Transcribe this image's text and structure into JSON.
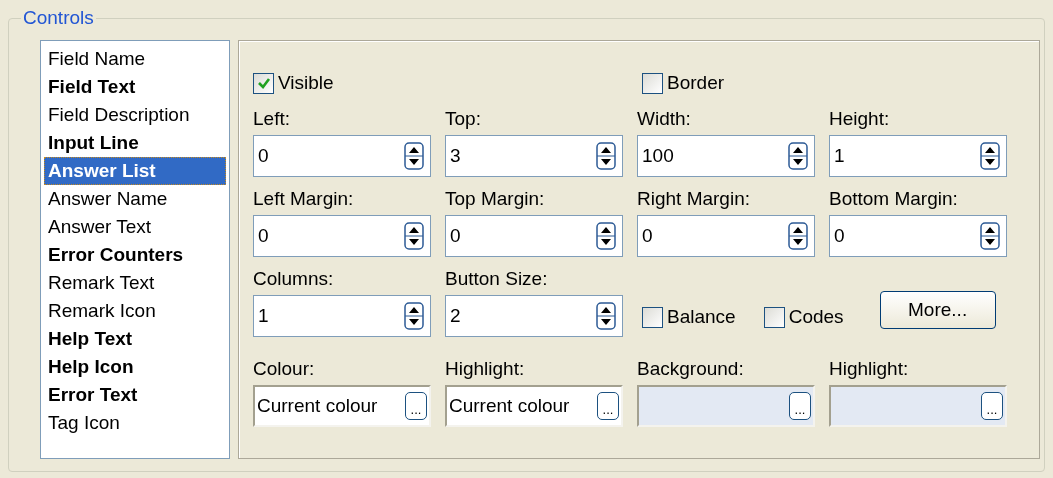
{
  "group_title": "Controls",
  "list": [
    {
      "label": "Field Name",
      "bold": false,
      "selected": false
    },
    {
      "label": "Field Text",
      "bold": true,
      "selected": false
    },
    {
      "label": "Field Description",
      "bold": false,
      "selected": false
    },
    {
      "label": "Input Line",
      "bold": true,
      "selected": false
    },
    {
      "label": "Answer List",
      "bold": true,
      "selected": true
    },
    {
      "label": "Answer Name",
      "bold": false,
      "selected": false
    },
    {
      "label": "Answer Text",
      "bold": false,
      "selected": false
    },
    {
      "label": "Error Counters",
      "bold": true,
      "selected": false
    },
    {
      "label": "Remark Text",
      "bold": false,
      "selected": false
    },
    {
      "label": "Remark Icon",
      "bold": false,
      "selected": false
    },
    {
      "label": "Help Text",
      "bold": true,
      "selected": false
    },
    {
      "label": "Help Icon",
      "bold": true,
      "selected": false
    },
    {
      "label": "Error Text",
      "bold": true,
      "selected": false
    },
    {
      "label": "Tag Icon",
      "bold": false,
      "selected": false
    }
  ],
  "visible": {
    "label": "Visible",
    "checked": true
  },
  "border": {
    "label": "Border",
    "checked": false
  },
  "spin_fields": [
    {
      "label": "Left:",
      "value": "0"
    },
    {
      "label": "Top:",
      "value": "3"
    },
    {
      "label": "Width:",
      "value": "100"
    },
    {
      "label": "Height:",
      "value": "1"
    },
    {
      "label": "Left Margin:",
      "value": "0"
    },
    {
      "label": "Top Margin:",
      "value": "0"
    },
    {
      "label": "Right Margin:",
      "value": "0"
    },
    {
      "label": "Bottom Margin:",
      "value": "0"
    },
    {
      "label": "Columns:",
      "value": "1"
    },
    {
      "label": "Button Size:",
      "value": "2"
    }
  ],
  "balance": {
    "label": "Balance",
    "checked": false
  },
  "codes": {
    "label": "Codes",
    "checked": false
  },
  "more_button": "More...",
  "colour_fields": [
    {
      "label": "Colour:",
      "value": "Current colour",
      "button": "...",
      "disabled": false
    },
    {
      "label": "Highlight:",
      "value": "Current colour",
      "button": "...",
      "disabled": false
    },
    {
      "label": "Background:",
      "button": "...",
      "disabled": true
    },
    {
      "label": "Highlight:",
      "button": "...",
      "disabled": true
    }
  ]
}
